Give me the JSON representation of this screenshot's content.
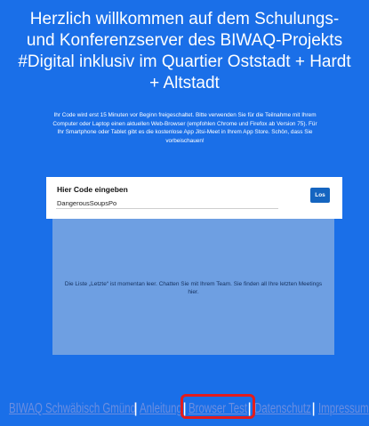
{
  "header": {
    "title": "Herzlich willkommen auf dem Schulungs- und Konferenzserver des BIWAQ-Projekts #Digital inklusiv im Quartier Oststadt + Hardt + Altstadt",
    "intro": "Ihr Code wird erst 15 Minuten vor Beginn freigeschaltet. Bitte verwenden Sie für die Teilnahme mit Ihrem Computer oder Laptop einen aktuellen Web-Browser (empfohlen Chrome und Firefox ab Version 75). Für Ihr Smartphone oder Tablet gibt es die kostenlose App Jitsi-Meet in Ihrem App Store. Schön, dass Sie vorbeischauen!"
  },
  "join": {
    "label": "Hier Code eingeben",
    "value": "DangerousSoupsPo",
    "button": "Los"
  },
  "recent": {
    "empty_text": "Die Liste „Letzte“ ist momentan leer. Chatten Sie mit Ihrem Team. Sie finden all Ihre letzten Meetings hier."
  },
  "footer": {
    "links": [
      "BIWAQ Schwäbisch Gmünd",
      "Anleitung",
      "Browser Test",
      "Datenschutz",
      "Impressum"
    ],
    "separator": "|",
    "highlighted": "Browser Test"
  },
  "colors": {
    "background": "#1a6fe8",
    "button": "#1565c0",
    "recent_panel": "#6e9fe2",
    "link": "#6b8ee0",
    "highlight": "#e31c1c"
  }
}
